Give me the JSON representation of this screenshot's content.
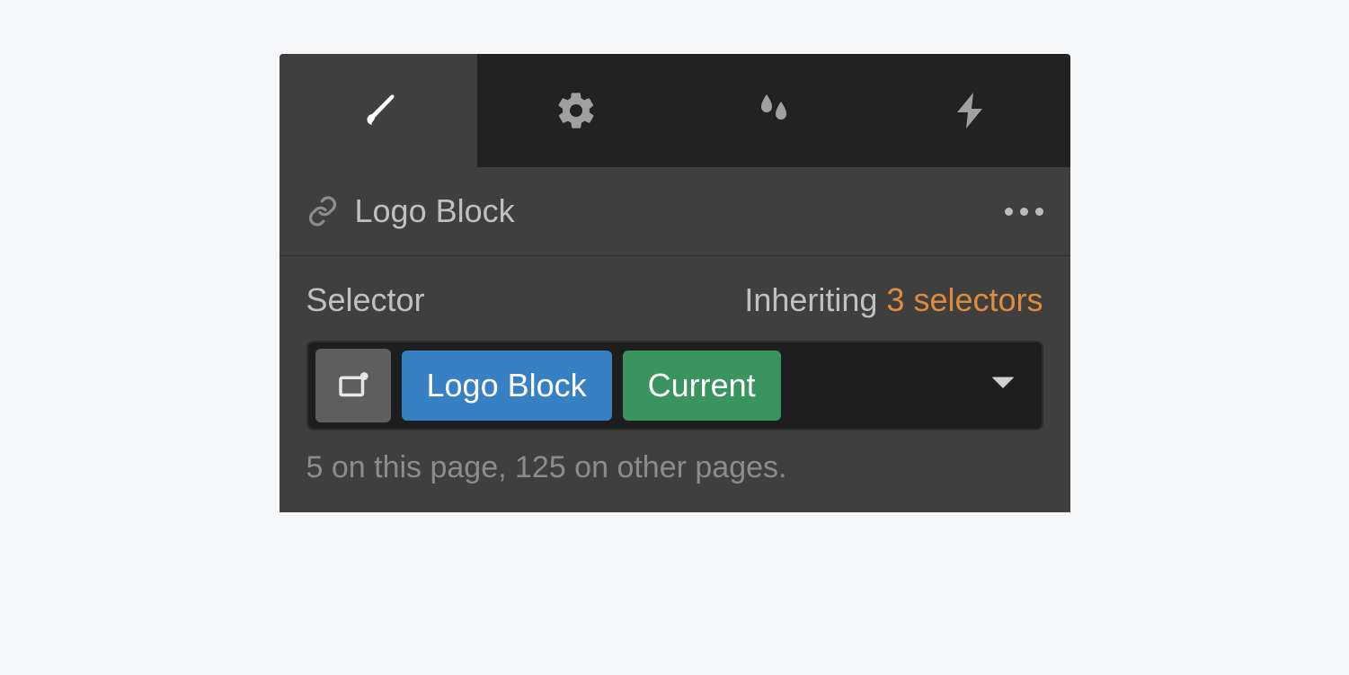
{
  "tabs": {
    "style": "brush-icon",
    "settings": "gear-icon",
    "effects": "droplets-icon",
    "interactions": "lightning-icon"
  },
  "element": {
    "name": "Logo Block"
  },
  "selector": {
    "label": "Selector",
    "inherit_prefix": "Inheriting ",
    "inherit_count": "3 selectors",
    "class_tag": "Logo Block",
    "state_tag": "Current",
    "usage": "5 on this page, 125 on other pages."
  },
  "colors": {
    "accent_orange": "#e08b3c",
    "tag_blue": "#3880c4",
    "tag_green": "#3a9460"
  }
}
